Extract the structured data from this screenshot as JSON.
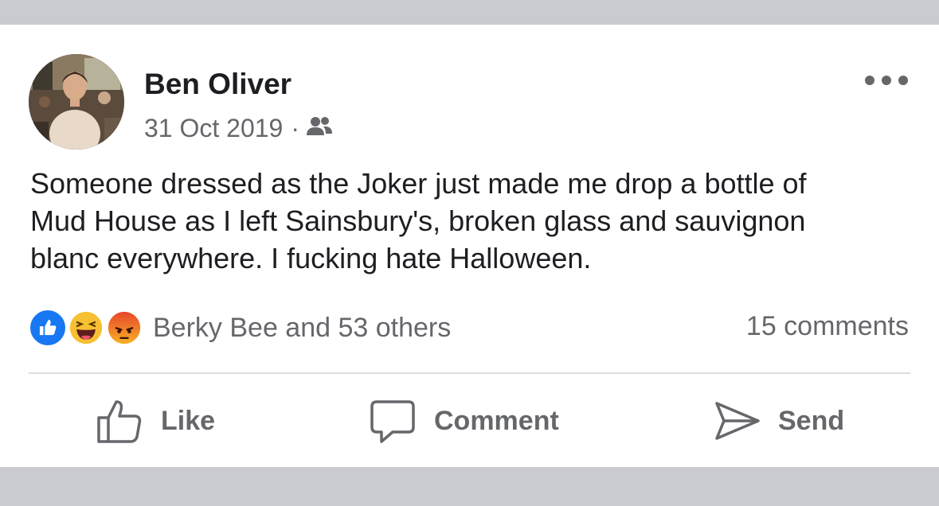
{
  "post": {
    "author": "Ben Oliver",
    "date": "31 Oct 2019",
    "separator": "·",
    "privacy_icon": "friends-icon",
    "text": "Someone dressed as the Joker just made me drop a bottle of\nMud House as I left Sainsbury's, broken glass and sauvignon\nblanc everywhere. I fucking hate Halloween.",
    "reactions_text": "Berky Bee and 53 others",
    "comments_text": "15 comments",
    "reaction_icons": [
      "like-reaction-icon",
      "haha-reaction-icon",
      "angry-reaction-icon"
    ]
  },
  "actions": {
    "like": "Like",
    "comment": "Comment",
    "send": "Send"
  },
  "colors": {
    "text_primary": "#1c1e21",
    "text_secondary": "#65676b",
    "like_blue": "#1877f2",
    "background": "#c9cbd0"
  }
}
